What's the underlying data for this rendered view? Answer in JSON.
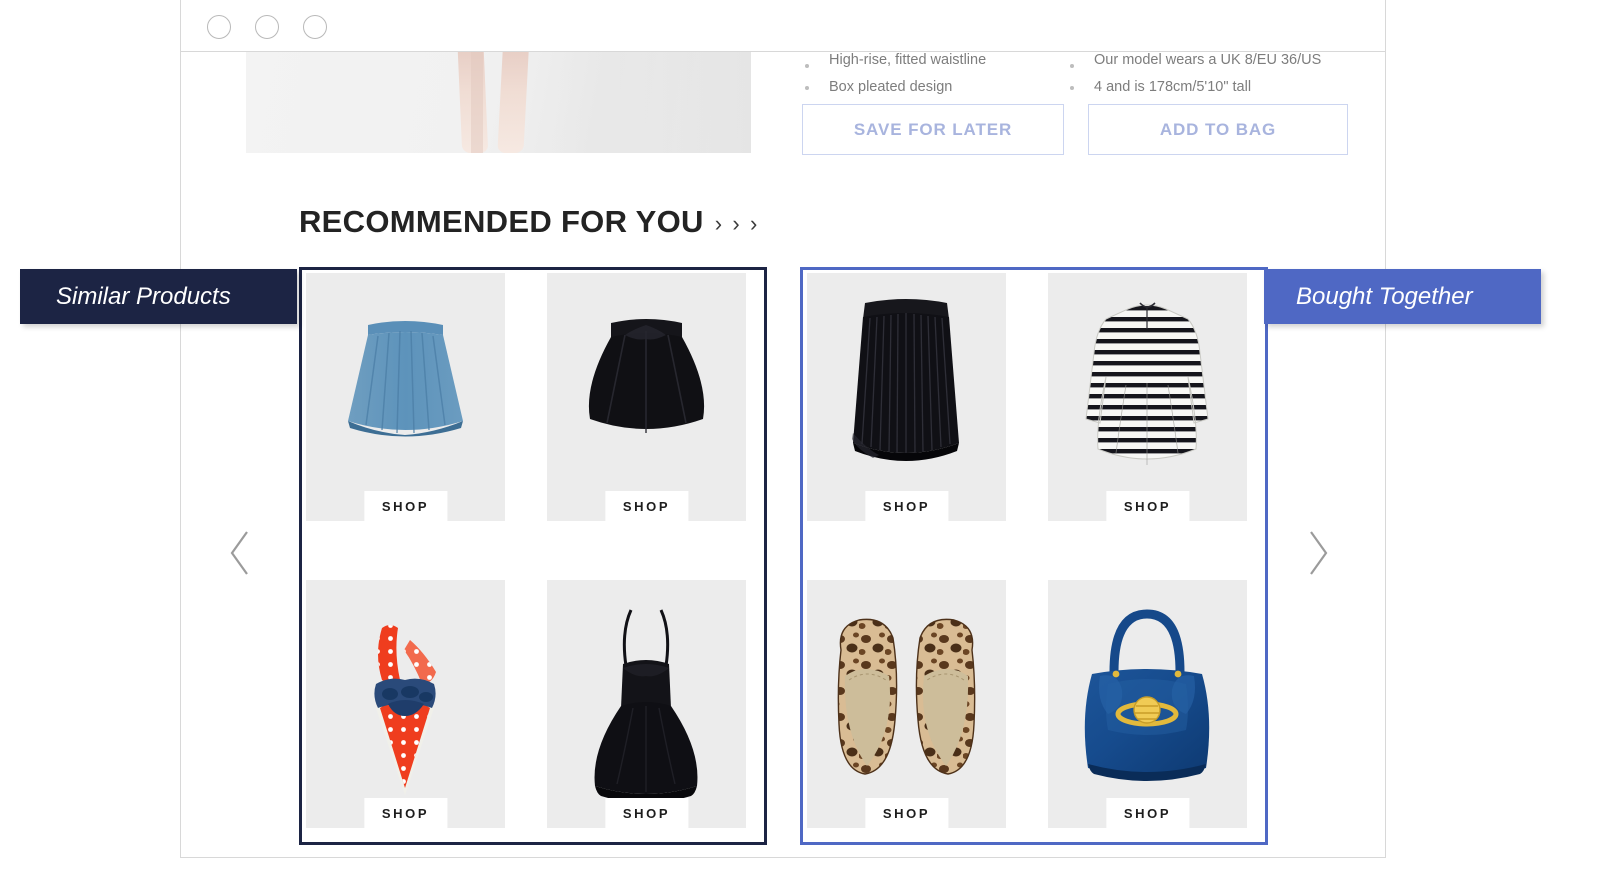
{
  "window": {
    "controls": [
      "window-dot-1",
      "window-dot-2",
      "window-dot-3"
    ]
  },
  "product_details": {
    "bullets_left": [
      "High-rise, fitted waistline",
      "Box pleated design"
    ],
    "bullets_right": [
      "Our model wears a UK 8/EU 36/US",
      "4 and is 178cm/5'10\" tall"
    ],
    "buttons": {
      "save_label": "SAVE FOR LATER",
      "bag_label": "ADD TO BAG"
    }
  },
  "recommendations": {
    "heading": "RECOMMENDED FOR YOU",
    "heading_chevrons": [
      "›",
      "›",
      "›"
    ],
    "prev_arrow": "‹",
    "next_arrow": "›",
    "shop_label": "SHOP",
    "panels": [
      {
        "badge": "Similar Products",
        "accent": "#1c2444",
        "items": [
          {
            "name": "blue-pleated-skirt",
            "shop": "SHOP"
          },
          {
            "name": "black-skater-skirt",
            "shop": "SHOP"
          },
          {
            "name": "red-polka-dot-scarf",
            "shop": "SHOP"
          },
          {
            "name": "black-cami-dress",
            "shop": "SHOP"
          }
        ]
      },
      {
        "badge": "Bought Together",
        "accent": "#4f68c4",
        "items": [
          {
            "name": "black-accordion-pleat-skirt",
            "shop": "SHOP"
          },
          {
            "name": "striped-skater-dress",
            "shop": "SHOP"
          },
          {
            "name": "leopard-print-loafers",
            "shop": "SHOP"
          },
          {
            "name": "blue-patent-handbag",
            "shop": "SHOP"
          }
        ]
      }
    ]
  },
  "colors": {
    "navy": "#1c2444",
    "periwinkle": "#4f68c4",
    "tile_bg": "#ececec",
    "button_text": "#a8b4de"
  }
}
